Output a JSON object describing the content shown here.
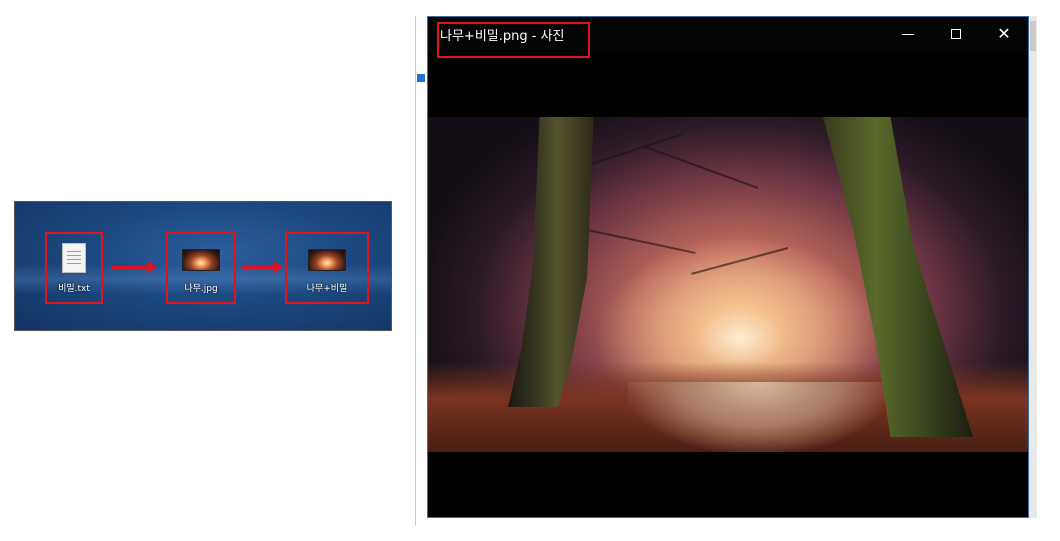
{
  "desktop": {
    "files": [
      {
        "label": "비밀.txt",
        "icon": "text-file-icon"
      },
      {
        "label": "나무.jpg",
        "icon": "image-file-icon"
      },
      {
        "label": "나무+비밀",
        "icon": "image-file-icon"
      }
    ]
  },
  "viewer": {
    "title": "나무+비밀.png - 사진",
    "controls": {
      "minimize": "minimize-icon",
      "maximize": "maximize-icon",
      "close": "✕"
    },
    "image_subject": "forest-path-photo"
  },
  "colors": {
    "highlight": "#e0141e",
    "desktop_bg": "#1c4880",
    "viewer_bg": "#000000"
  }
}
